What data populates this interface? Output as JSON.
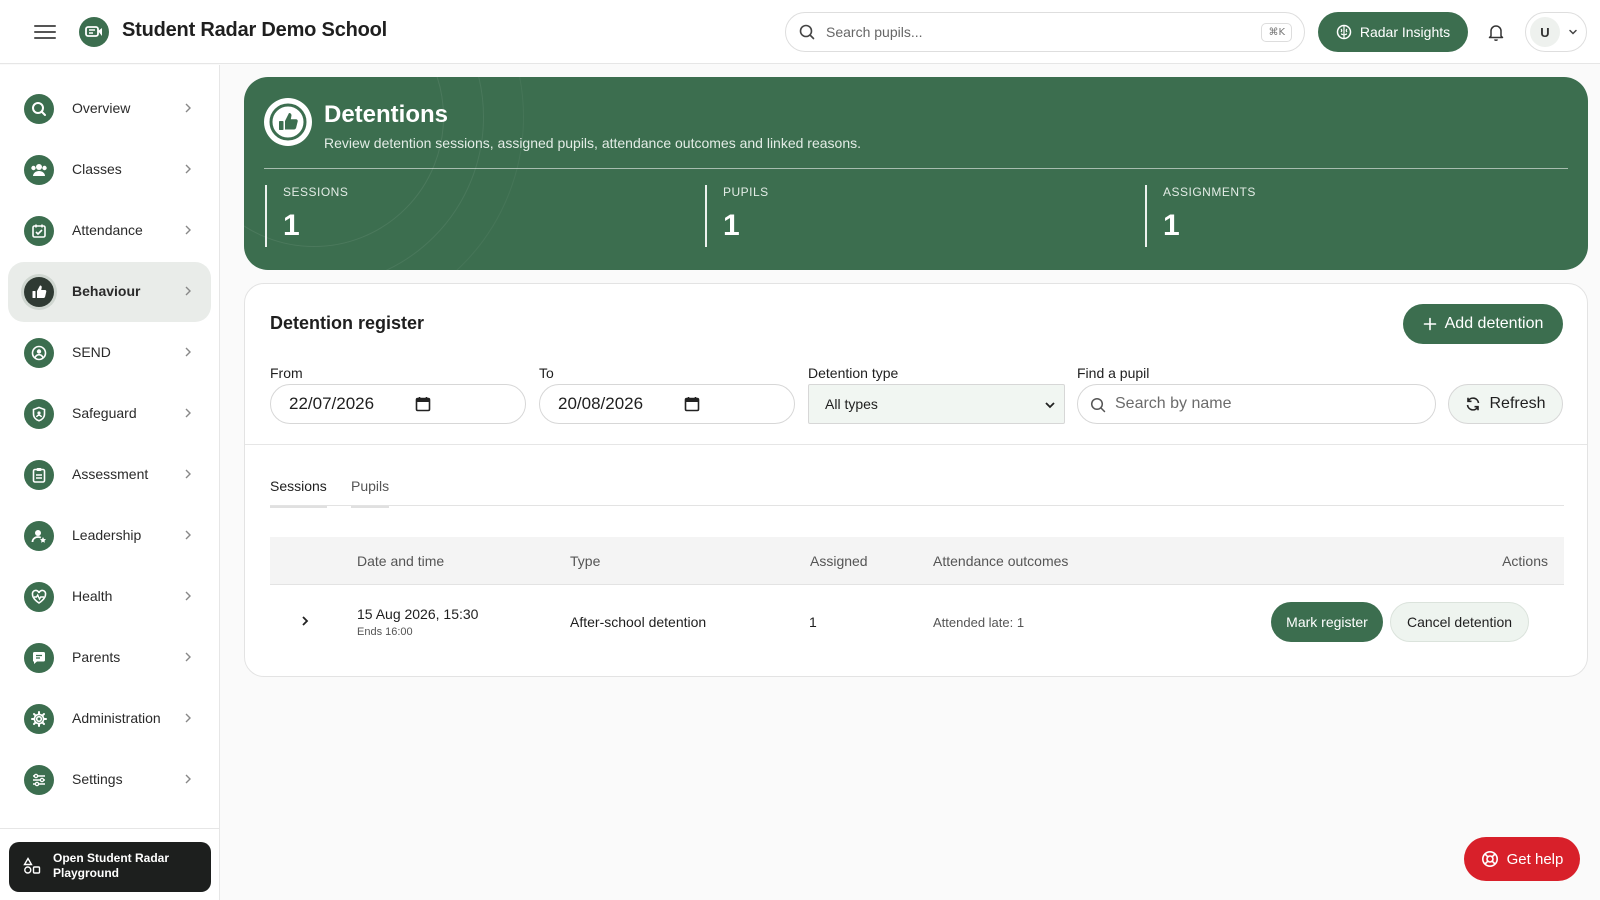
{
  "header": {
    "app_title": "Student Radar Demo School",
    "search_placeholder": "Search pupils...",
    "search_shortcut": "⌘K",
    "insights_label": "Radar Insights",
    "user_initial": "U"
  },
  "sidebar": {
    "items": [
      {
        "label": "Overview",
        "icon": "search-icon"
      },
      {
        "label": "Classes",
        "icon": "users-icon"
      },
      {
        "label": "Attendance",
        "icon": "calendar-check-icon"
      },
      {
        "label": "Behaviour",
        "icon": "thumbs-up-icon",
        "active": true
      },
      {
        "label": "SEND",
        "icon": "person-circle-icon"
      },
      {
        "label": "Safeguard",
        "icon": "shield-icon"
      },
      {
        "label": "Assessment",
        "icon": "clipboard-icon"
      },
      {
        "label": "Leadership",
        "icon": "person-star-icon"
      },
      {
        "label": "Health",
        "icon": "heart-pulse-icon"
      },
      {
        "label": "Parents",
        "icon": "chat-icon"
      },
      {
        "label": "Administration",
        "icon": "gear-icon"
      },
      {
        "label": "Settings",
        "icon": "sliders-icon"
      }
    ],
    "playground_label": "Open Student Radar Playground"
  },
  "hero": {
    "title": "Detentions",
    "subtitle": "Review detention sessions, assigned pupils, attendance outcomes and linked reasons.",
    "stats": [
      {
        "label": "SESSIONS",
        "value": "1"
      },
      {
        "label": "PUPILS",
        "value": "1"
      },
      {
        "label": "ASSIGNMENTS",
        "value": "1"
      }
    ]
  },
  "register": {
    "title": "Detention register",
    "add_label": "Add detention",
    "from_label": "From",
    "from_value": "22/07/2026",
    "to_label": "To",
    "to_value": "20/08/2026",
    "type_label": "Detention type",
    "type_value": "All types",
    "find_label": "Find a pupil",
    "find_placeholder": "Search by name",
    "refresh_label": "Refresh",
    "tabs": [
      {
        "label": "Sessions",
        "active": true
      },
      {
        "label": "Pupils",
        "active": false
      }
    ],
    "columns": [
      "Date and time",
      "Type",
      "Assigned",
      "Attendance outcomes",
      "Actions"
    ],
    "rows": [
      {
        "date": "15 Aug 2026, 15:30",
        "ends": "Ends 16:00",
        "type": "After-school detention",
        "assigned": "1",
        "attendance": "Attended late: 1",
        "mark_label": "Mark register",
        "cancel_label": "Cancel detention"
      }
    ]
  },
  "help_label": "Get help",
  "colors": {
    "brand_green": "#3c6e4f",
    "danger_red": "#d8202a"
  }
}
